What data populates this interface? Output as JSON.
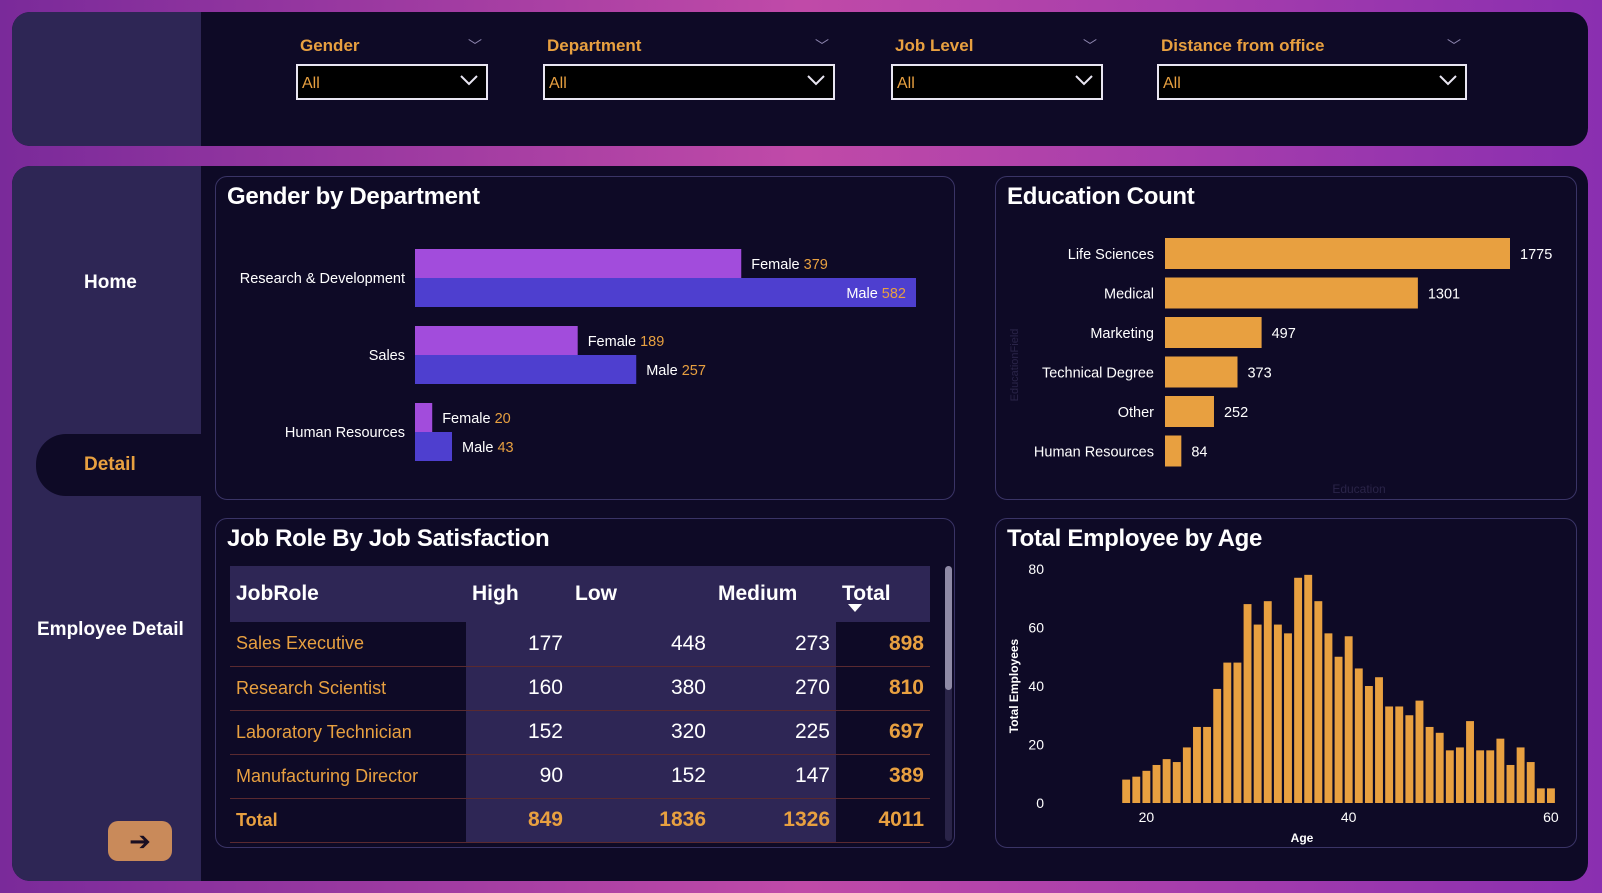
{
  "filters": [
    {
      "label": "Gender",
      "value": "All"
    },
    {
      "label": "Department",
      "value": "All"
    },
    {
      "label": "Job Level",
      "value": "All"
    },
    {
      "label": "Distance from office",
      "value": "All"
    }
  ],
  "nav": {
    "home": "Home",
    "detail": "Detail",
    "employee_detail": "Employee Detail",
    "next_arrow": "➔"
  },
  "colors": {
    "accent": "#e8a040",
    "female": "#a24cdc",
    "male": "#4e3fcf",
    "panel": "#0e0a26",
    "sidebar": "#2e2655"
  },
  "gender_card": {
    "title": "Gender by Department"
  },
  "education_card": {
    "title": "Education Count",
    "ylabel": "EducationField",
    "xlabel": "Education"
  },
  "table_card": {
    "title": "Job Role By Job Satisfaction",
    "headers": [
      "JobRole",
      "High",
      "Low",
      "Medium",
      "Total"
    ],
    "rows": [
      {
        "role": "Sales Executive",
        "high": "177",
        "low": "448",
        "medium": "273",
        "total": "898"
      },
      {
        "role": "Research Scientist",
        "high": "160",
        "low": "380",
        "medium": "270",
        "total": "810"
      },
      {
        "role": "Laboratory Technician",
        "high": "152",
        "low": "320",
        "medium": "225",
        "total": "697"
      },
      {
        "role": "Manufacturing Director",
        "high": "90",
        "low": "152",
        "medium": "147",
        "total": "389"
      }
    ],
    "total_row": {
      "role": "Total",
      "high": "849",
      "low": "1836",
      "medium": "1326",
      "total": "4011"
    }
  },
  "age_card": {
    "title": "Total Employee by Age"
  },
  "chart_data": [
    {
      "type": "bar",
      "orientation": "horizontal",
      "title": "Gender by Department",
      "categories": [
        "Research & Development",
        "Sales",
        "Human Resources"
      ],
      "series": [
        {
          "name": "Female",
          "values": [
            379,
            189,
            20
          ]
        },
        {
          "name": "Male",
          "values": [
            582,
            257,
            43
          ]
        }
      ]
    },
    {
      "type": "bar",
      "orientation": "horizontal",
      "title": "Education Count",
      "xlabel": "Education",
      "ylabel": "EducationField",
      "categories": [
        "Life Sciences",
        "Medical",
        "Marketing",
        "Technical Degree",
        "Other",
        "Human Resources"
      ],
      "values": [
        1775,
        1301,
        497,
        373,
        252,
        84
      ]
    },
    {
      "type": "bar",
      "title": "Total Employee by Age",
      "xlabel": "Age",
      "ylabel": "Total Employees",
      "x": [
        18,
        19,
        20,
        21,
        22,
        23,
        24,
        25,
        26,
        27,
        28,
        29,
        30,
        31,
        32,
        33,
        34,
        35,
        36,
        37,
        38,
        39,
        40,
        41,
        42,
        43,
        44,
        45,
        46,
        47,
        48,
        49,
        50,
        51,
        52,
        53,
        54,
        55,
        56,
        57,
        58,
        59,
        60
      ],
      "values": [
        8,
        9,
        11,
        13,
        15,
        14,
        19,
        26,
        26,
        39,
        48,
        48,
        68,
        61,
        69,
        61,
        58,
        77,
        78,
        69,
        58,
        50,
        57,
        46,
        40,
        43,
        33,
        33,
        30,
        35,
        26,
        24,
        18,
        19,
        28,
        18,
        18,
        22,
        13,
        19,
        14,
        5,
        5
      ],
      "xticks": [
        20,
        40,
        60
      ],
      "yticks": [
        0,
        20,
        40,
        60,
        80
      ],
      "ylim": [
        0,
        80
      ],
      "xlim": [
        16.5,
        60.5
      ]
    }
  ]
}
